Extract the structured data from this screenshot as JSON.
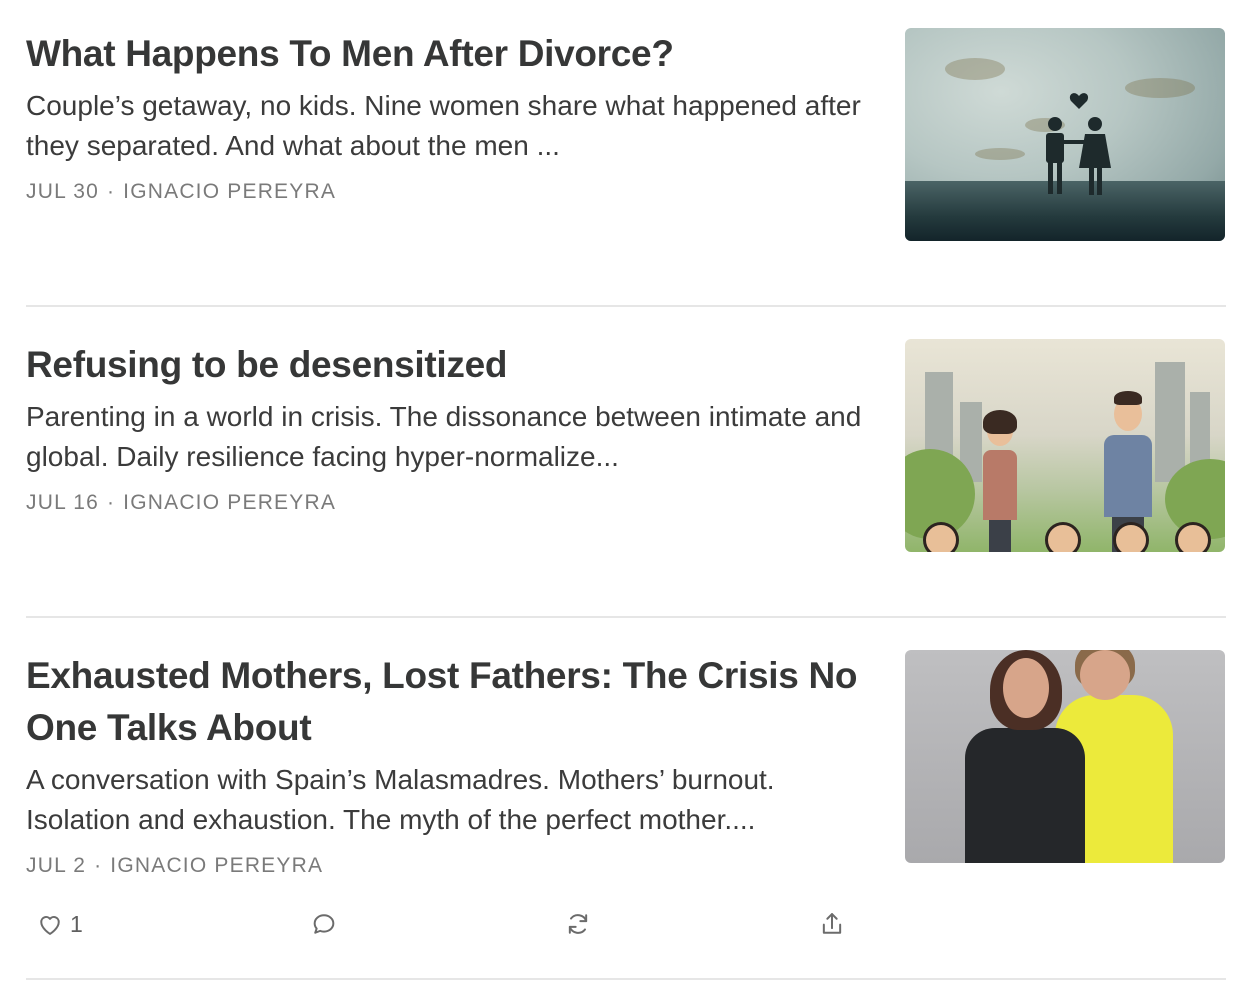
{
  "posts": [
    {
      "title": "What Happens To Men After Divorce?",
      "subtitle": "Couple’s getaway, no kids. Nine women share what happened after they separated. And what about the men ...",
      "date": "JUL 30",
      "separator": "·",
      "author": "IGNACIO PEREYRA"
    },
    {
      "title": "Refusing to be desensitized",
      "subtitle": "Parenting in a world in crisis. The dissonance between intimate and global. Daily resilience facing hyper-normalize...",
      "date": "JUL 16",
      "separator": "·",
      "author": "IGNACIO PEREYRA"
    },
    {
      "title": "Exhausted Mothers, Lost Fathers: The Crisis No One Talks About",
      "subtitle": "A conversation with Spain’s Malasmadres. Mothers’ burnout. Isolation and exhaustion. The myth of the perfect mother....",
      "date": "JUL 2",
      "separator": "·",
      "author": "IGNACIO PEREYRA"
    }
  ],
  "actions": {
    "like_count": "1",
    "icons": [
      "heart-icon",
      "comment-icon",
      "restack-icon",
      "share-icon"
    ]
  }
}
